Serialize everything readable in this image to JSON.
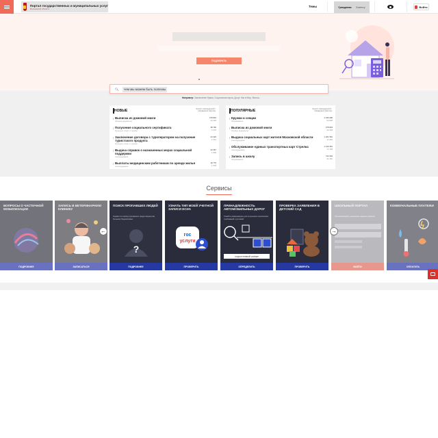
{
  "header": {
    "menu_icon": "hamburger-menu-icon",
    "brand_title": "Портал государственных и муниципальных услуг",
    "brand_subtitle": "Московской области",
    "nav_themes": "Темы",
    "audience_citizens": "Гражданам",
    "audience_business": "Бизнесу",
    "vision_icon": "eye-icon",
    "login_label": "Войти"
  },
  "hero": {
    "search_button": "ПОДОБРАТЬ",
    "query_icon": "search-icon",
    "query_text": "чем мы можем быть полезны",
    "examples_label": "Например:",
    "examples_text": "Заключение брака, Социальная карта, Досуг, Как в Мир, Жилья..."
  },
  "new_list": {
    "title": "НОВЫЕ",
    "subtitle": "ВСЕГО ОБРАЩЕНИЙ / СРЕДНЕЕ В МЕСЯЦ",
    "items": [
      {
        "title": "Выписка из домовой книги",
        "category": "Личные документы",
        "stat1": "478 823",
        "stat2": "24 418"
      },
      {
        "title": "Получение социального сертификата",
        "category": "Культура, спорт и туризм",
        "stat1": "38 792",
        "stat2": "2 276"
      },
      {
        "title": "Заключение договора с туроператором на получение туристского продукта",
        "category": "Культура, спорт и туризм",
        "stat1": "24 423",
        "stat2": "1 941"
      },
      {
        "title": "Выдача справок о назначенных мерах социальной поддержки",
        "category": "Соцподдержка",
        "stat1": "23 357",
        "stat2": "1 809"
      },
      {
        "title": "Выплаты медицинским работникам по аренде жилья",
        "category": "Соцподдержка",
        "stat1": "18 770",
        "stat2": "1 378"
      }
    ]
  },
  "popular_list": {
    "title": "ПОПУЛЯРНЫЕ",
    "subtitle": "ВСЕГО ОБРАЩЕНИЙ / СРЕДНЕЕ В МЕСЯЦ",
    "items": [
      {
        "title": "Кружки и секции",
        "category": "Образование",
        "stat1": "2 195 996",
        "stat2": "64 528"
      },
      {
        "title": "Выписка из домовой книги",
        "category": "Личные документы",
        "stat1": "478 823",
        "stat2": "24 418"
      },
      {
        "title": "Выдача социальных карт жителя Московской области",
        "category": "Соцподдержка",
        "stat1": "1 201 561",
        "stat2": "14 346"
      },
      {
        "title": "Обслуживание единых транспортных карт Стрелка",
        "category": "Соцподдержка",
        "stat1": "1 216 351",
        "stat2": "17 138"
      },
      {
        "title": "Запись в школу",
        "category": "Образование",
        "stat1": "744 303",
        "stat2": "21 461"
      }
    ]
  },
  "services": {
    "title": "Сервисы",
    "prev_icon": "arrow-left-icon",
    "next_icon": "arrow-right-icon",
    "cards": [
      {
        "title": "Вопросы о частичной мобилизации",
        "desc": "",
        "button": "ПОДРОБНЕЕ"
      },
      {
        "title": "Запись в ветеринарную клинику",
        "desc": "",
        "button": "ЗАПИСАТЬСЯ"
      },
      {
        "title": "Поиск пропавших людей",
        "desc": "Сервис по поиску пропавших среди пациентов больниц Подмосковья",
        "button": "ПОДРОБНЕЕ"
      },
      {
        "title": "Узнать тип моей учетной записи ЕСИА",
        "desc": "",
        "button": "ПРОВЕРИТЬ"
      },
      {
        "title": "Принадлежность автомобильных дорог",
        "desc": "Узнайте информацию для получения технических требований и условий",
        "button": "ОПРЕДЕЛИТЬ",
        "extra_button": "КАДАСТРОВЫЙ НОМЕР"
      },
      {
        "title": "Проверка заявления в детский сад",
        "desc": "",
        "button": "ПРОВЕРИТЬ"
      },
      {
        "title": "Школьный портал",
        "desc": "Просматривайте домашние задания ребенка",
        "button": "ВОЙТИ"
      },
      {
        "title": "Коммунальные платежи",
        "desc": "",
        "button": "ОПЛАТИТЬ"
      }
    ]
  },
  "chat_icon": "chat-icon"
}
